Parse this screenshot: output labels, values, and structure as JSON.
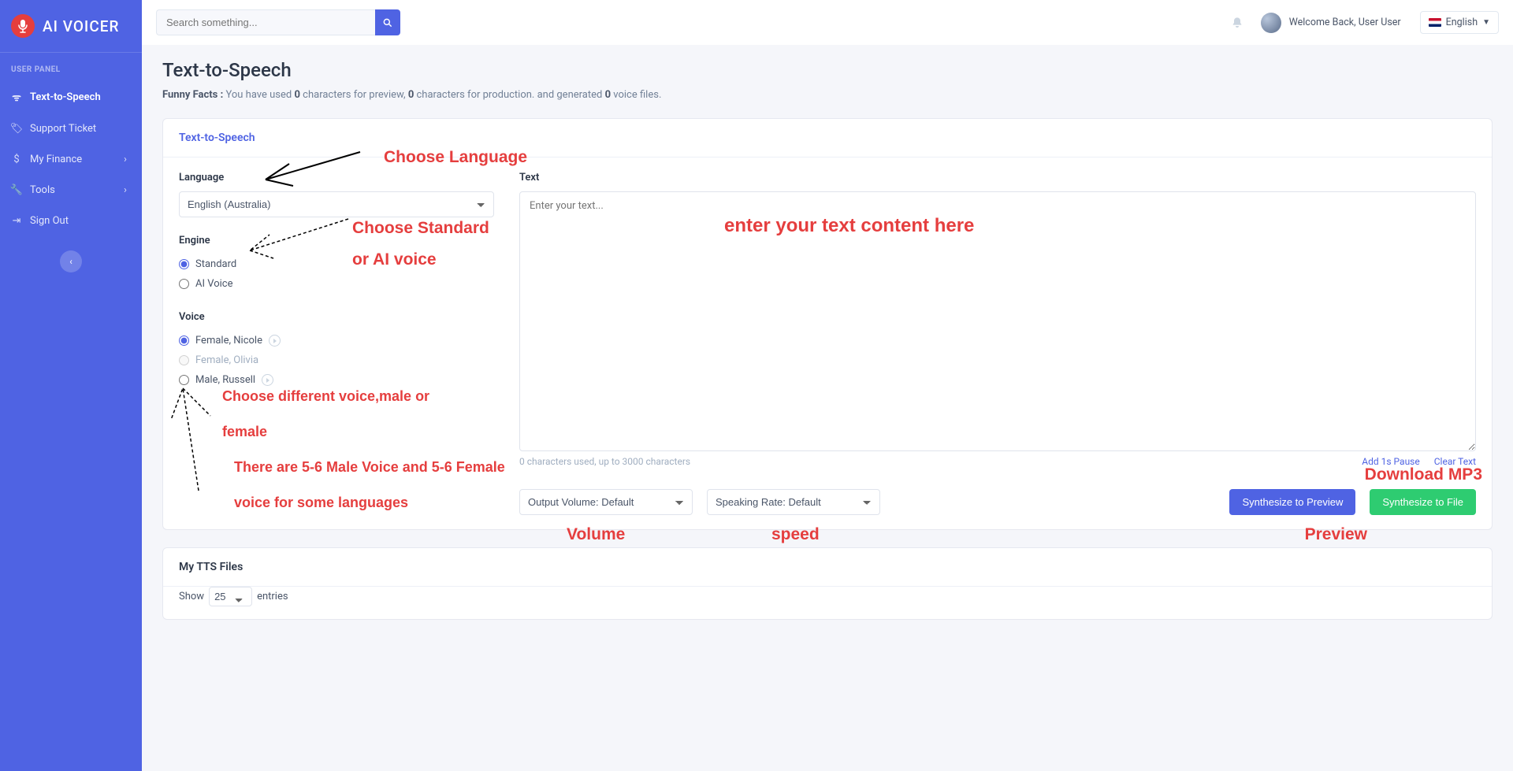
{
  "brand": {
    "name": "AI VOICER"
  },
  "sidebar": {
    "panel_label": "USER PANEL",
    "items": [
      {
        "label": "Text-to-Speech"
      },
      {
        "label": "Support Ticket"
      },
      {
        "label": "My Finance"
      },
      {
        "label": "Tools"
      },
      {
        "label": "Sign Out"
      }
    ]
  },
  "topbar": {
    "search_placeholder": "Search something...",
    "welcome": "Welcome Back, User User",
    "lang": "English"
  },
  "page": {
    "title": "Text-to-Speech",
    "funny_prefix": "Funny Facts :",
    "funny_1": " You have used ",
    "funny_v1": "0",
    "funny_2": " characters for preview, ",
    "funny_v2": "0",
    "funny_3": " characters for production. and generated ",
    "funny_v3": "0",
    "funny_4": " voice files."
  },
  "card": {
    "title": "Text-to-Speech",
    "language_label": "Language",
    "language_value": "English (Australia)",
    "engine_label": "Engine",
    "engine_options": [
      {
        "label": "Standard"
      },
      {
        "label": "AI Voice"
      }
    ],
    "voice_label": "Voice",
    "voice_options": [
      {
        "label": "Female, Nicole"
      },
      {
        "label": "Female, Olivia"
      },
      {
        "label": "Male, Russell"
      }
    ],
    "text_label": "Text",
    "text_placeholder": "Enter your text...",
    "char_counter": "0 characters used, up to 3000 characters",
    "add_pause": "Add 1s Pause",
    "clear_text": "Clear Text",
    "volume_label": "Output Volume: Default",
    "rate_label": "Speaking Rate: Default",
    "btn_preview": "Synthesize to Preview",
    "btn_file": "Synthesize to File"
  },
  "files_card": {
    "title": "My TTS Files",
    "show": "Show",
    "entries": "entries"
  },
  "annotations": {
    "choose_lang": "Choose Language",
    "choose_engine1": "Choose Standard",
    "choose_engine2": "or AI voice",
    "enter_text": "enter your text content here",
    "choose_voice1": "Choose different voice,male or",
    "choose_voice2": "female",
    "choose_voice3": "There are 5-6 Male Voice and 5-6 Female",
    "choose_voice4": "voice for some languages",
    "download": "Download MP3",
    "volume": "Volume",
    "speed": "speed",
    "preview": "Preview"
  }
}
